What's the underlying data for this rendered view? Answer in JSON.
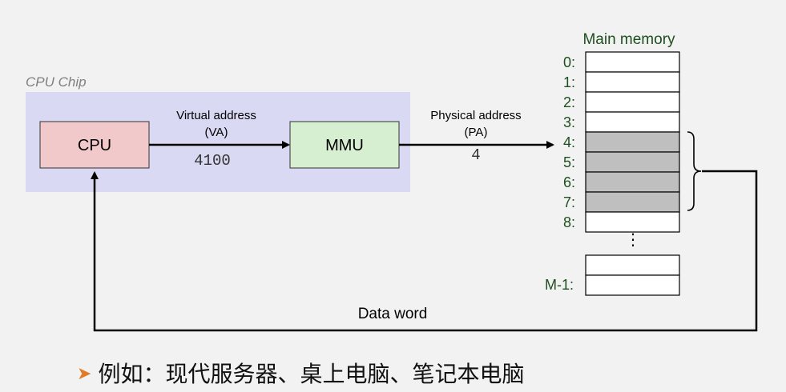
{
  "chip": {
    "label": "CPU Chip"
  },
  "cpu": {
    "label": "CPU"
  },
  "mmu": {
    "label": "MMU"
  },
  "virtual_address": {
    "line1": "Virtual address",
    "line2": "(VA)",
    "value": "4100"
  },
  "physical_address": {
    "line1": "Physical address",
    "line2": "(PA)",
    "value": "4"
  },
  "memory": {
    "title": "Main memory",
    "rows": [
      {
        "label": "0:",
        "highlighted": false
      },
      {
        "label": "1:",
        "highlighted": false
      },
      {
        "label": "2:",
        "highlighted": false
      },
      {
        "label": "3:",
        "highlighted": false
      },
      {
        "label": "4:",
        "highlighted": true
      },
      {
        "label": "5:",
        "highlighted": true
      },
      {
        "label": "6:",
        "highlighted": true
      },
      {
        "label": "7:",
        "highlighted": true
      },
      {
        "label": "8:",
        "highlighted": false
      }
    ],
    "ellipsis": "⋮",
    "last_label": "M-1:"
  },
  "data_word": "Data word",
  "bullet": {
    "icon": "arrow-bullet-icon",
    "text": "例如：现代服务器、桌上电脑、笔记本电脑"
  },
  "colors": {
    "chip_bg": "#d9d9f3",
    "cpu_fill": "#f2c9cb",
    "mmu_fill": "#d6efd0",
    "memory_highlight": "#bfbfbf",
    "memory_label": "#1f4e1f",
    "bullet_arrow": "#e07b2a"
  }
}
